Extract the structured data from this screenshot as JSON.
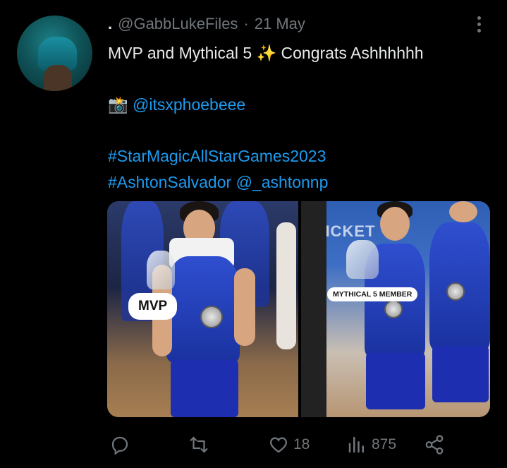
{
  "tweet": {
    "avatar_icon": "user-avatar",
    "prefix": ".",
    "handle": "@GabbLukeFiles",
    "separator": "·",
    "date": "21 May",
    "lines": {
      "line1": "MVP and Mythical 5 ✨ Congrats Ashhhhhh",
      "photo_emoji": "📸",
      "mention1": "@itsxphoebeee",
      "hashtag1": "#StarMagicAllStarGames2023",
      "hashtag2": "#AshtonSalvador",
      "mention2": "@_ashtonnp"
    }
  },
  "media": {
    "left_label": "MVP",
    "right_label": "MYTHICAL 5 MEMBER",
    "sign_text": "TICKET"
  },
  "actions": {
    "reply_icon": "reply-icon",
    "retweet_icon": "retweet-icon",
    "like_icon": "heart-icon",
    "like_count": "18",
    "views_icon": "views-icon",
    "views_count": "875",
    "share_icon": "share-icon"
  },
  "colors": {
    "background": "#000000",
    "text": "#e7e9ea",
    "muted": "#71767b",
    "link": "#1d9bf0"
  }
}
